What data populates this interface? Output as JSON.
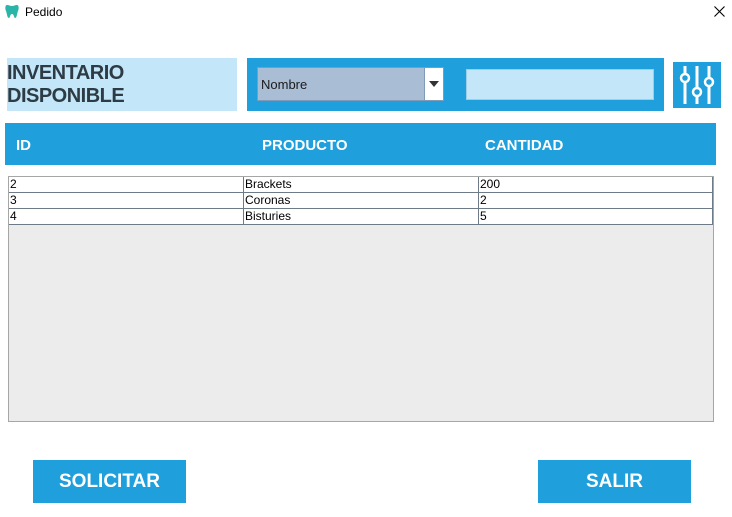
{
  "window": {
    "title": "Pedido",
    "icon": "tooth-icon",
    "close_icon": "close-icon"
  },
  "header": {
    "inventory_label": "INVENTARIO DISPONIBLE"
  },
  "search": {
    "filter_select_value": "Nombre",
    "search_value": "",
    "filter_button_icon": "sliders-icon"
  },
  "table": {
    "columns": [
      "ID",
      "PRODUCTO",
      "CANTIDAD"
    ],
    "rows": [
      [
        "2",
        "Brackets",
        "200"
      ],
      [
        "3",
        "Coronas",
        "2"
      ],
      [
        "4",
        "Bisturies",
        "5"
      ]
    ]
  },
  "actions": {
    "solicitar_label": "SOLICITAR",
    "salir_label": "SALIR"
  },
  "colors": {
    "accent": "#1f9fdb",
    "light_accent": "#c3e6f8",
    "select_bg": "#a9bdd4"
  }
}
